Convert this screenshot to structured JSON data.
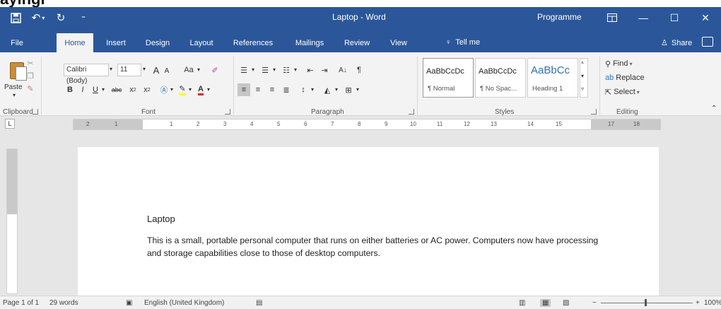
{
  "window": {
    "title": "Laptop - Word",
    "program_label": "Programme",
    "crop_text": "ayingi"
  },
  "tabs": [
    "File",
    "Home",
    "Insert",
    "Design",
    "Layout",
    "References",
    "Mailings",
    "Review",
    "View"
  ],
  "active_tab": "Home",
  "tell_me": "Tell me",
  "share": "Share",
  "ribbon": {
    "clipboard": {
      "paste": "Paste",
      "label": "Clipboard"
    },
    "font": {
      "family": "Calibri (Body)",
      "size": "11",
      "grow": "A",
      "shrink": "A",
      "case": "Aa",
      "bold": "B",
      "italic": "I",
      "underline": "U",
      "strike": "abc",
      "sub": "x",
      "sup": "x",
      "label": "Font"
    },
    "paragraph": {
      "sort": "A↓",
      "pilcrow": "¶",
      "label": "Paragraph"
    },
    "styles": {
      "items": [
        {
          "sample": "AaBbCcDc",
          "name": "¶ Normal"
        },
        {
          "sample": "AaBbCcDc",
          "name": "¶ No Spac..."
        },
        {
          "sample": "AaBbCc",
          "name": "Heading 1"
        }
      ],
      "label": "Styles"
    },
    "editing": {
      "find": "Find",
      "replace": "Replace",
      "select": "Select",
      "label": "Editing"
    }
  },
  "ruler": {
    "numbers": [
      "2",
      "1",
      "1",
      "2",
      "3",
      "4",
      "5",
      "6",
      "7",
      "8",
      "9",
      "10",
      "11",
      "12",
      "13",
      "14",
      "15",
      "17",
      "18"
    ]
  },
  "document": {
    "title": "Laptop",
    "body": "This is a small, portable personal computer that runs on either batteries or AC power. Computers now have processing and storage capabilities close to those of desktop computers."
  },
  "status": {
    "page": "Page 1 of 1",
    "words": "29 words",
    "language": "English (United Kingdom)",
    "zoom": "100%"
  },
  "colors": {
    "accent": "#2b579a",
    "heading": "#2e74b5"
  }
}
